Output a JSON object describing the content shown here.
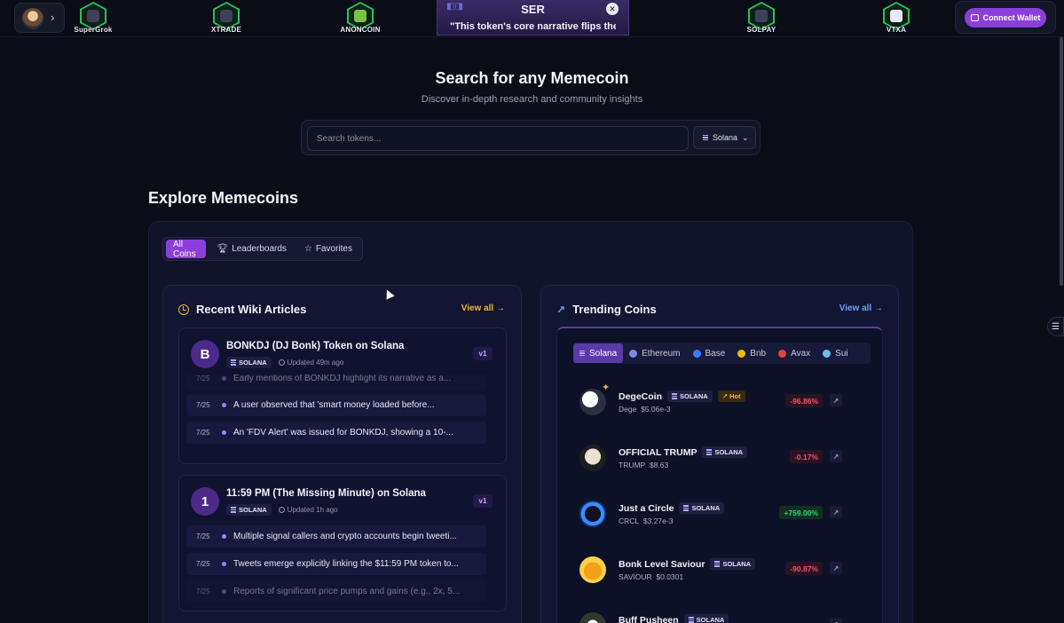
{
  "topbar": {
    "logos": [
      {
        "label": "SuperGrok",
        "color": "#22c55e"
      },
      {
        "label": "XTRADE",
        "color": "#22c55e"
      },
      {
        "label": "ANONCOIN",
        "color": "#22c55e"
      },
      {
        "label": "SOLPAY",
        "color": "#22c55e"
      },
      {
        "label": "VTXA",
        "color": "#22c55e"
      }
    ],
    "popup": {
      "title": "SER",
      "quote": "\"This token's core narrative flips the scr"
    },
    "connect_label": "Connect Wallet"
  },
  "hero": {
    "title": "Search for any Memecoin",
    "subtitle": "Discover in-depth research and community insights",
    "search_placeholder": "Search tokens...",
    "chain": "Solana"
  },
  "explore": {
    "title": "Explore Memecoins",
    "tabs": [
      {
        "label": "All Coins",
        "icon": "grid",
        "active": true
      },
      {
        "label": "Leaderboards",
        "icon": "trophy-icon",
        "active": false
      },
      {
        "label": "Favorites",
        "icon": "star-icon",
        "active": false
      }
    ]
  },
  "wiki": {
    "title": "Recent Wiki Articles",
    "view_all": "View all →",
    "articles": [
      {
        "badge": "B",
        "title": "BONKDJ (DJ Bonk) Token on Solana",
        "chain": "SOLANA",
        "updated": "Updated 49m ago",
        "version": "v1",
        "items": [
          {
            "date": "7/25",
            "text": "Early mentions of BONKDJ highlight its narrative as a...",
            "faded": true
          },
          {
            "date": "7/25",
            "text": "A user observed that 'smart money loaded before...",
            "faded": false
          },
          {
            "date": "7/25",
            "text": "An 'FDV Alert' was issued for BONKDJ, showing a 10-...",
            "faded": false
          }
        ]
      },
      {
        "badge": "1",
        "title": "11:59 PM (The Missing Minute) on Solana",
        "chain": "SOLANA",
        "updated": "Updated 1h ago",
        "version": "v1",
        "items": [
          {
            "date": "7/25",
            "text": "Multiple signal callers and crypto accounts begin tweeti...",
            "faded": false
          },
          {
            "date": "7/25",
            "text": "Tweets emerge explicitly linking the $11:59 PM token to...",
            "faded": false
          },
          {
            "date": "7/25",
            "text": "Reports of significant price pumps and gains (e.g., 2x, 5...",
            "faded": true
          }
        ]
      }
    ]
  },
  "trending": {
    "title": "Trending Coins",
    "view_all": "View all →",
    "chains": [
      {
        "label": "Solana",
        "active": true,
        "color": "#b6a9ff"
      },
      {
        "label": "Ethereum",
        "active": false,
        "color": "#7a8ae0"
      },
      {
        "label": "Base",
        "active": false,
        "color": "#3b7bff"
      },
      {
        "label": "Bnb",
        "active": false,
        "color": "#f0b90b"
      },
      {
        "label": "Avax",
        "active": false,
        "color": "#e84142"
      },
      {
        "label": "Sui",
        "active": false,
        "color": "#6fbcf0"
      }
    ],
    "coins": [
      {
        "name": "DegeCoin",
        "chain": "SOLANA",
        "hot": "Hot",
        "ticker": "Dege",
        "price": "$5.06e-3",
        "change": "-96.86%",
        "dir": "down",
        "logo_text": "Dege"
      },
      {
        "name": "OFFICIAL TRUMP",
        "chain": "SOLANA",
        "hot": "",
        "ticker": "TRUMP",
        "price": "$8.63",
        "change": "-0.17%",
        "dir": "down",
        "logo_text": ""
      },
      {
        "name": "Just a Circle",
        "chain": "SOLANA",
        "hot": "",
        "ticker": "CRCL",
        "price": "$3.27e-3",
        "change": "+759.00%",
        "dir": "up",
        "logo_text": ""
      },
      {
        "name": "Bonk Level Saviour",
        "chain": "SOLANA",
        "hot": "",
        "ticker": "SAVIOUR",
        "price": "$0.0301",
        "change": "-90.87%",
        "dir": "down",
        "logo_text": ""
      },
      {
        "name": "Buff Pusheen",
        "chain": "SOLANA",
        "hot": "",
        "ticker": "",
        "price": "",
        "change": "",
        "dir": "down",
        "logo_text": ""
      }
    ]
  }
}
